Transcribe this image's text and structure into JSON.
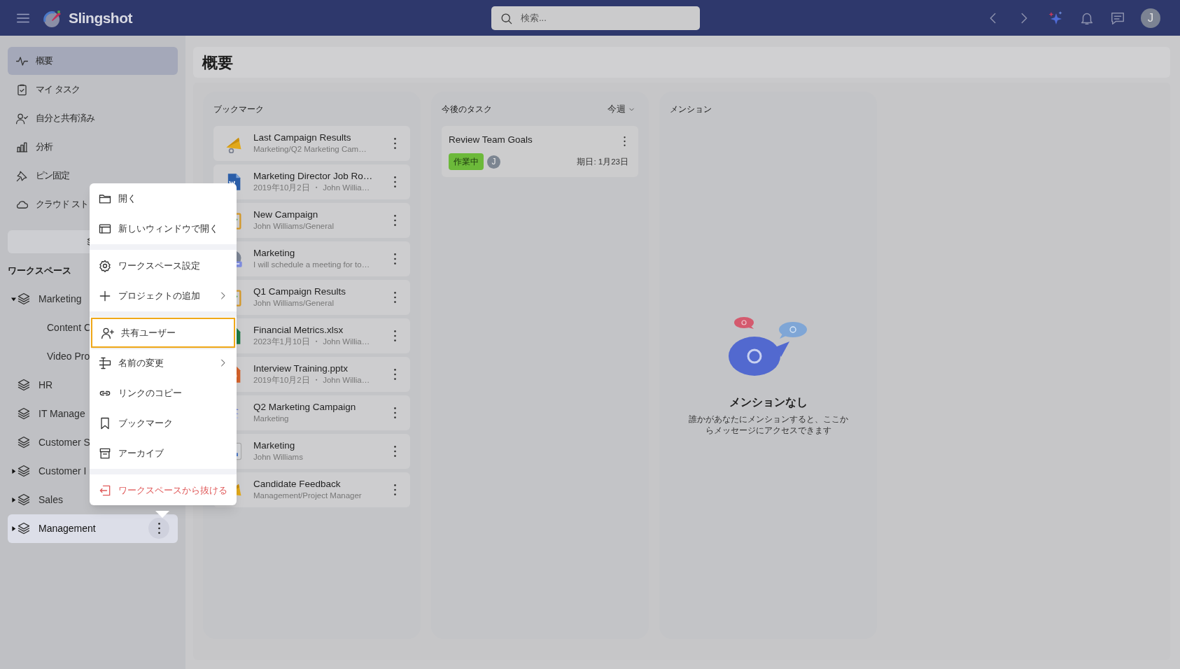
{
  "header": {
    "brand": "Slingshot",
    "search": {
      "placeholder": "検索..."
    },
    "avatar": "J"
  },
  "nav": [
    {
      "label": "概要",
      "selected": true
    },
    {
      "label": "マイ タスク",
      "selected": false
    },
    {
      "label": "自分と共有済み",
      "selected": false
    },
    {
      "label": "分析",
      "selected": false
    },
    {
      "label": "ピン固定",
      "selected": false
    },
    {
      "label": "クラウド スト",
      "selected": false
    }
  ],
  "workspaces": {
    "title": "ワークスペース",
    "items": [
      {
        "label": "Marketing",
        "expanded": true,
        "selected": false,
        "children": [
          {
            "label": "Content C",
            "selected": false
          },
          {
            "label": "Video Pro",
            "selected": false
          }
        ]
      },
      {
        "label": "HR",
        "selected": false
      },
      {
        "label": "IT Manage",
        "selected": false
      },
      {
        "label": "Customer S",
        "selected": false
      },
      {
        "label": "Customer I",
        "expanded": false,
        "selected": false
      },
      {
        "label": "Sales",
        "expanded": false,
        "selected": false
      },
      {
        "label": "Management",
        "expanded": false,
        "selected": true
      }
    ]
  },
  "context_menu": [
    {
      "kind": "item",
      "label": "開く",
      "focused": false
    },
    {
      "kind": "item",
      "label": "新しいウィンドウで開く",
      "focused": false
    },
    {
      "kind": "divider"
    },
    {
      "kind": "item",
      "label": "ワークスペース設定",
      "focused": false
    },
    {
      "kind": "item",
      "label": "プロジェクトの追加",
      "focused": false,
      "submenu": true
    },
    {
      "kind": "divider"
    },
    {
      "kind": "item",
      "label": "共有ユーザー",
      "focused": true
    },
    {
      "kind": "item",
      "label": "名前の変更",
      "focused": false,
      "submenu": true
    },
    {
      "kind": "item",
      "label": "リンクのコピー",
      "focused": false
    },
    {
      "kind": "item",
      "label": "ブックマーク",
      "focused": false
    },
    {
      "kind": "item",
      "label": "アーカイブ",
      "focused": false
    },
    {
      "kind": "divider"
    },
    {
      "kind": "danger",
      "label": "ワークスペースから抜ける",
      "focused": false
    }
  ],
  "page_title": "概要",
  "bookmarks": {
    "title": "ブックマーク",
    "items": [
      {
        "kind": "campaign",
        "title": "Last Campaign Results",
        "subtitle": "Marketing/Q2 Marketing Cam…"
      },
      {
        "kind": "document",
        "title": "Marketing Director Job Ro…",
        "subtitle": "2019年10月2日 ・ John Willia…"
      },
      {
        "kind": "task",
        "title": "New Campaign",
        "subtitle": "John Williams/General"
      },
      {
        "kind": "message",
        "title": "Marketing",
        "subtitle": "I will schedule a meeting for to…"
      },
      {
        "kind": "task",
        "title": "Q1 Campaign Results",
        "subtitle": "John Williams/General"
      },
      {
        "kind": "spreadsheet",
        "title": "Financial Metrics.xlsx",
        "subtitle": "2023年1月10日 ・ John Willia…"
      },
      {
        "kind": "presentation",
        "title": "Interview Training.pptx",
        "subtitle": "2019年10月2日 ・ John Willia…"
      },
      {
        "kind": "project",
        "title": "Q2 Marketing Campaign",
        "subtitle": "Marketing"
      },
      {
        "kind": "dashboard",
        "title": "Marketing",
        "subtitle": "John Williams"
      },
      {
        "kind": "campaign",
        "title": "Candidate Feedback",
        "subtitle": "Management/Project Manager"
      }
    ]
  },
  "tasks": {
    "title": "今後のタスク",
    "filter": "今週",
    "items": [
      {
        "title": "Review Team Goals",
        "status": "作業中",
        "assignee": "J",
        "due": "期日: 1月23日"
      }
    ]
  },
  "mentions": {
    "title": "メンション",
    "empty_title": "メンションなし",
    "empty_text": "誰かがあなたにメンションすると、ここからメッセージにアクセスできます"
  }
}
